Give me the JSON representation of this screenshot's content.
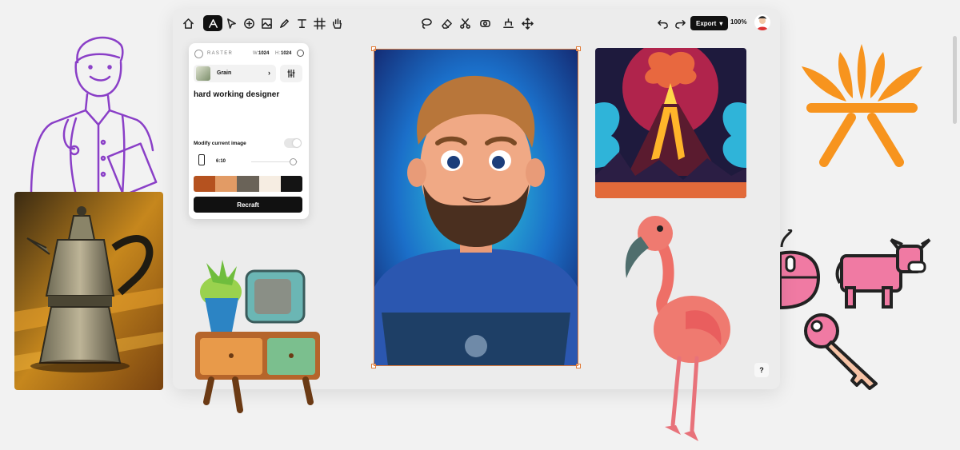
{
  "toolbar": {
    "left_tools": [
      "home-icon",
      "recraft-logo-icon",
      "pointer-icon",
      "vector-tool-icon",
      "image-frame-icon",
      "pen-icon",
      "text-icon",
      "frame-icon",
      "hand-icon"
    ],
    "center_tools": [
      "lasso-icon",
      "eraser-icon",
      "scissors-icon",
      "mockup-icon",
      "upscale-icon",
      "move-icon"
    ],
    "export_label": "Export",
    "zoom_label": "100%"
  },
  "panel": {
    "mode_label": "RASTER",
    "width_label": "W:",
    "width_value": "1024",
    "height_label": "H:",
    "height_value": "1024",
    "style_label": "Grain",
    "prompt_text": "hard working designer",
    "modify_label": "Modify current image",
    "ratio_label": "6:10",
    "palette": [
      "#b5521f",
      "#e29b65",
      "#6a6358",
      "#f6ede2",
      "#141414"
    ],
    "recraft_label": "Recraft"
  },
  "help_label": "?"
}
